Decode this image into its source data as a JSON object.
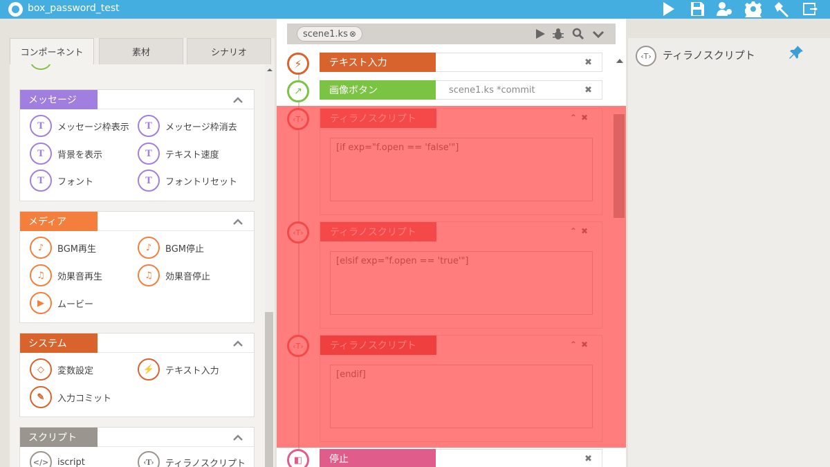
{
  "app": {
    "title": "box_password_test"
  },
  "toolbar": {
    "icons": [
      "play-icon",
      "save-icon",
      "users-gear-icon",
      "settings-icon",
      "build-hammer-icon",
      "export-icon"
    ]
  },
  "left_panel": {
    "tabs": [
      {
        "label": "コンポーネント",
        "active": true
      },
      {
        "label": "素材",
        "active": false
      },
      {
        "label": "シナリオ",
        "active": false
      }
    ],
    "sections": [
      {
        "label": "メッセージ",
        "color": "#a07fe0",
        "items": [
          {
            "label": "メッセージ枠表示",
            "icon": "message-show-icon"
          },
          {
            "label": "メッセージ枠消去",
            "icon": "message-hide-icon"
          },
          {
            "label": "背景を表示",
            "icon": "background-icon"
          },
          {
            "label": "テキスト速度",
            "icon": "text-speed-icon"
          },
          {
            "label": "フォント",
            "icon": "font-icon"
          },
          {
            "label": "フォントリセット",
            "icon": "font-reset-icon"
          }
        ]
      },
      {
        "label": "メディア",
        "color": "#f47f3c",
        "items": [
          {
            "label": "BGM再生",
            "icon": "bgm-play-icon"
          },
          {
            "label": "BGM停止",
            "icon": "bgm-stop-icon"
          },
          {
            "label": "効果音再生",
            "icon": "se-play-icon"
          },
          {
            "label": "効果音停止",
            "icon": "se-stop-icon"
          },
          {
            "label": "ムービー",
            "icon": "movie-icon"
          }
        ]
      },
      {
        "label": "システム",
        "color": "#d8632c",
        "items": [
          {
            "label": "変数設定",
            "icon": "variable-icon"
          },
          {
            "label": "テキスト入力",
            "icon": "text-input-icon"
          },
          {
            "label": "入力コミット",
            "icon": "input-commit-icon"
          }
        ]
      },
      {
        "label": "スクリプト",
        "color": "#9a958e",
        "items": [
          {
            "label": "iscript",
            "icon": "iscript-icon"
          },
          {
            "label": "ティラノスクリプト",
            "icon": "tyrano-script-icon"
          }
        ]
      }
    ]
  },
  "editor": {
    "file_tab": "scene1.ks",
    "file_tab_close": "⊗",
    "commands": [
      {
        "label": "テキスト入力",
        "color": "#d8632c",
        "param": ""
      },
      {
        "label": "画像ボタン",
        "color": "#7bc342",
        "param": "scene1.ks *commit"
      }
    ],
    "scripts": [
      {
        "label": "ティラノスクリプト",
        "code": "[if exp=\"f.open == 'false'\"]"
      },
      {
        "label": "ティラノスクリプト",
        "code": "[elsif exp=\"f.open == 'true'\"]"
      },
      {
        "label": "ティラノスクリプト",
        "code": "[endif]"
      }
    ],
    "last_command": {
      "label": "停止",
      "color": "#e05c8a"
    },
    "close_glyph": "✖",
    "node_tyrano_glyph": "‹T›"
  },
  "right_panel": {
    "title": "ティラノスクリプト",
    "icon_glyph": "‹T›"
  }
}
